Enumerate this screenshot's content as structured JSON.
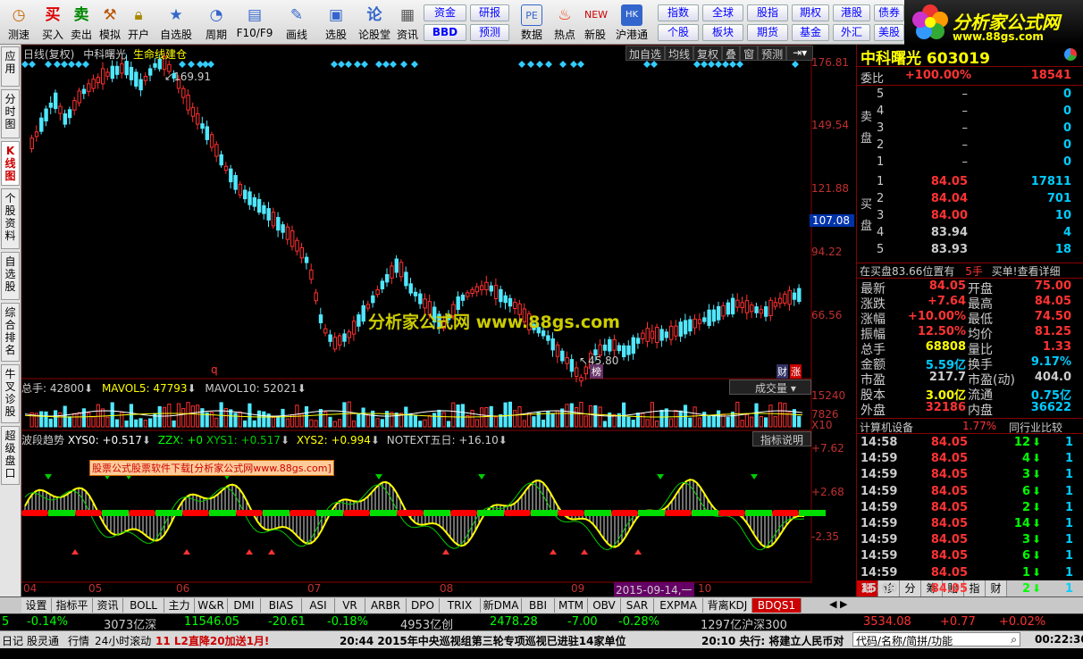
{
  "toolbar": {
    "items": [
      "测速",
      "买入",
      "卖出",
      "模拟",
      "开户",
      "自选股",
      "周期",
      "F10/F9",
      "画线",
      "选股",
      "论股堂",
      "资讯",
      "",
      "数据",
      "热点",
      "新股",
      "沪港通"
    ],
    "quick": [
      [
        "资金",
        "研报",
        "指数",
        "全球",
        "股指",
        "期权",
        "港股",
        "债券"
      ],
      [
        "BBD",
        "预测",
        "个股",
        "板块",
        "期货",
        "基金",
        "外汇",
        "美股"
      ]
    ]
  },
  "logo": {
    "name": "分析家公式网",
    "url": "www.88gs.com"
  },
  "left_tabs": [
    "应用",
    "分时图",
    "K线图",
    "个股资料",
    "自选股",
    "综合排名",
    "牛叉诊股",
    "超级盘口"
  ],
  "chart": {
    "period": "日线(复权)",
    "stock": "中科曙光",
    "indicator": "生命线建仓",
    "controls": [
      "加自选",
      "均线",
      "复权",
      "叠",
      "窗",
      "预测"
    ],
    "yticks": [
      "176.81",
      "149.54",
      "121.88",
      "94.22",
      "66.56"
    ],
    "current_price_tag": "107.08",
    "high_label": "169.91",
    "low_label": "45.80",
    "watermark": "分析家公式网   www.88gs.com",
    "badges": [
      "财",
      "涨"
    ],
    "bang": "榜"
  },
  "volume": {
    "total": "总手: 42800",
    "mavol5": "MAVOL5: 47793",
    "mavol10": "MAVOL10: 52021",
    "selector": "成交量",
    "yticks": [
      "15240",
      "7826",
      "X10"
    ]
  },
  "osc": {
    "title": "波段趋势",
    "xys0": "XYS0: +0.517",
    "zzx": "ZZX: +0",
    "xys1": "XYS1: +0.517",
    "xys2": "XYS2: +0.994",
    "notext": "NOTEXT五日: +16.10",
    "help": "指标说明",
    "ad": "股票公式股票软件下载[分析家公式网www.88gs.com]",
    "yticks": [
      "+7.62",
      "+2.68",
      "-2.35"
    ]
  },
  "dates": [
    "04",
    "05",
    "06",
    "07",
    "08",
    "09",
    "10"
  ],
  "date_cursor": "2015-09-14,一",
  "chart_data": {
    "type": "candlestick",
    "title": "中科曙光 日线(复权)",
    "ylim": [
      45.8,
      176.81
    ],
    "high": 169.91,
    "low": 45.8,
    "last_close": 84.05,
    "volume": {
      "total": 42800,
      "mavol5": 47793,
      "mavol10": 52021
    },
    "oscillator": {
      "XYS0": 0.517,
      "ZZX": 0,
      "XYS1": 0.517,
      "XYS2": 0.994,
      "NOTEXT": 16.1
    }
  },
  "right": {
    "name": "中科曙光",
    "code": "603019",
    "weibi": "委比",
    "weibi_pct": "+100.00%",
    "weibi_vol": "18541",
    "sell_label": "卖盘",
    "buy_label": "买盘",
    "sell": [
      [
        "5",
        "–",
        "0"
      ],
      [
        "4",
        "–",
        "0"
      ],
      [
        "3",
        "–",
        "0"
      ],
      [
        "2",
        "–",
        "0"
      ],
      [
        "1",
        "–",
        "0"
      ]
    ],
    "buy": [
      [
        "1",
        "84.05",
        "17811"
      ],
      [
        "2",
        "84.04",
        "701"
      ],
      [
        "3",
        "84.00",
        "10"
      ],
      [
        "4",
        "83.94",
        "4"
      ],
      [
        "5",
        "83.93",
        "18"
      ]
    ],
    "note": "在买盘83.66位置有",
    "note_vol": "5手",
    "note_link": "买单!查看详细",
    "stats": [
      [
        "最新",
        "84.05",
        "开盘",
        "75.00"
      ],
      [
        "涨跌",
        "+7.64",
        "最高",
        "84.05"
      ],
      [
        "涨幅",
        "+10.00%",
        "最低",
        "74.50"
      ],
      [
        "振幅",
        "12.50%",
        "均价",
        "81.25"
      ],
      [
        "总手",
        "68808",
        "量比",
        "1.33"
      ],
      [
        "金额",
        "5.59亿",
        "换手",
        "9.17%"
      ],
      [
        "市盈",
        "217.7",
        "市盈(动)",
        "404.0"
      ],
      [
        "股本",
        "3.00亿",
        "流通",
        "0.75亿"
      ],
      [
        "外盘",
        "32186",
        "内盘",
        "36622"
      ]
    ],
    "industry": "计算机设备",
    "industry_pct": "1.77%",
    "peer": "同行业比较",
    "ticks": [
      [
        "14:58",
        "84.05",
        "12"
      ],
      [
        "14:59",
        "84.05",
        "4"
      ],
      [
        "14:59",
        "84.05",
        "3"
      ],
      [
        "14:59",
        "84.05",
        "6"
      ],
      [
        "14:59",
        "84.05",
        "2"
      ],
      [
        "14:59",
        "84.05",
        "14"
      ],
      [
        "14:59",
        "84.05",
        "3"
      ],
      [
        "14:59",
        "84.05",
        "6"
      ],
      [
        "14:59",
        "84.05",
        "1"
      ],
      [
        "15:00",
        "84.05",
        "2"
      ]
    ],
    "tabs": [
      "细",
      "诊",
      "分",
      "筹",
      "貽",
      "指",
      "财"
    ]
  },
  "bottom_tabs": [
    "设置",
    "指标平台",
    "资讯",
    "BOLL",
    "主力",
    "W&R",
    "DMI",
    "BIAS",
    "ASI",
    "VR",
    "ARBR",
    "DPO",
    "TRIX",
    "新DMA",
    "BBI",
    "MTM",
    "OBV",
    "SAR",
    "EXPMA",
    "背离KDJ",
    "BDQS1"
  ],
  "status": [
    "5",
    "-0.14%",
    "3073亿深",
    "11546.05",
    "-20.61",
    "-0.18%",
    "4953亿创",
    "2478.28",
    "-7.00",
    "-0.28%",
    "1297亿沪深300",
    "3534.08",
    "+0.77",
    "+0.02%"
  ],
  "news": [
    "日记",
    "股灵通",
    "行情",
    "24小时滚动",
    "11 L2直降20加送1月!",
    "20:44 2015年中央巡视组第三轮专项巡视已进驻14家单位",
    "20:10 央行: 将建立人民币对",
    "代码/名称/简拼/功能",
    "00:22:30"
  ]
}
